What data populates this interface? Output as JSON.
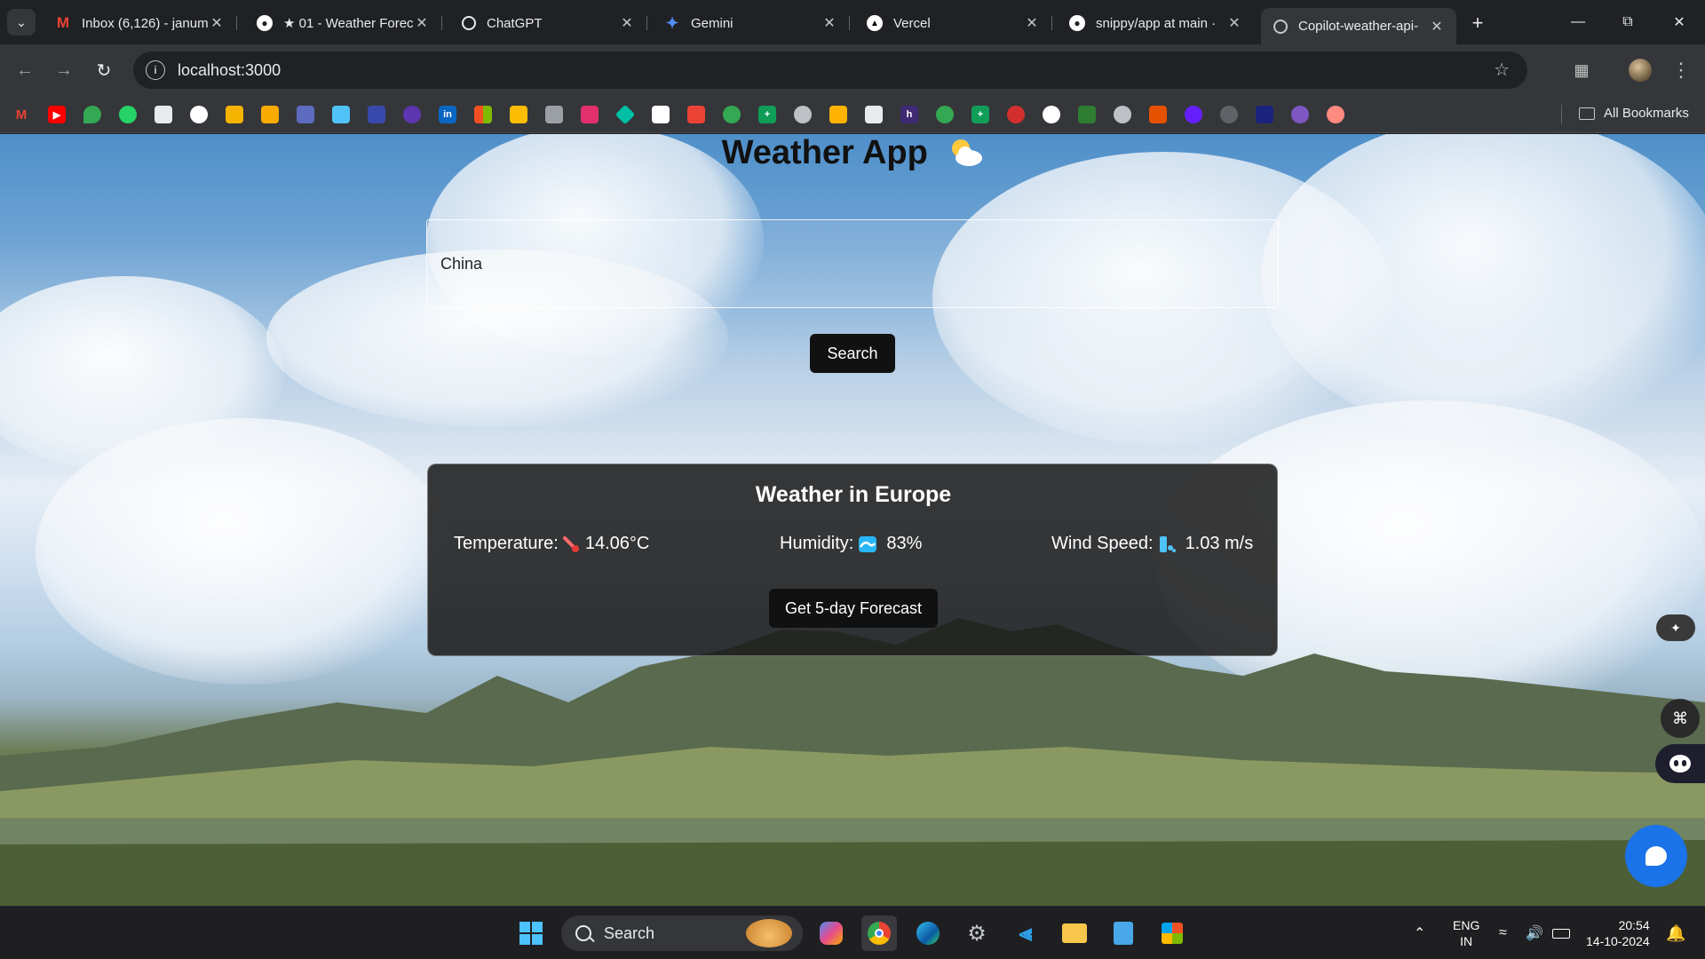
{
  "browser": {
    "tabs": [
      {
        "title": "Inbox (6,126) - janum",
        "icon": "gmail-icon"
      },
      {
        "title": "★ 01 - Weather Forec",
        "icon": "github-icon"
      },
      {
        "title": "ChatGPT",
        "icon": "chatgpt-icon"
      },
      {
        "title": "Gemini",
        "icon": "gemini-icon"
      },
      {
        "title": "Vercel",
        "icon": "vercel-icon"
      },
      {
        "title": "snippy/app at main ·",
        "icon": "github-icon"
      },
      {
        "title": "Copilot-weather-api-",
        "icon": "globe-icon",
        "active": true
      }
    ],
    "url": "localhost:3000",
    "all_bookmarks_label": "All Bookmarks"
  },
  "app": {
    "title": "Weather App",
    "search_value": "China",
    "search_button_label": "Search",
    "card": {
      "title": "Weather in Europe",
      "temperature_label": "Temperature:",
      "temperature_value": "14.06°C",
      "humidity_label": "Humidity:",
      "humidity_value": "83%",
      "wind_label": "Wind Speed:",
      "wind_value": "1.03 m/s",
      "forecast_button_label": "Get 5-day Forecast"
    }
  },
  "taskbar": {
    "search_placeholder": "Search",
    "language_top": "ENG",
    "language_bottom": "IN",
    "time": "20:54",
    "date": "14-10-2024"
  },
  "colors": {
    "chrome_dark": "#202124",
    "chrome_toolbar": "#35363a",
    "button_bg": "#111111",
    "card_bg": "#1c1c1c",
    "chat_bubble": "#1a73e8"
  }
}
